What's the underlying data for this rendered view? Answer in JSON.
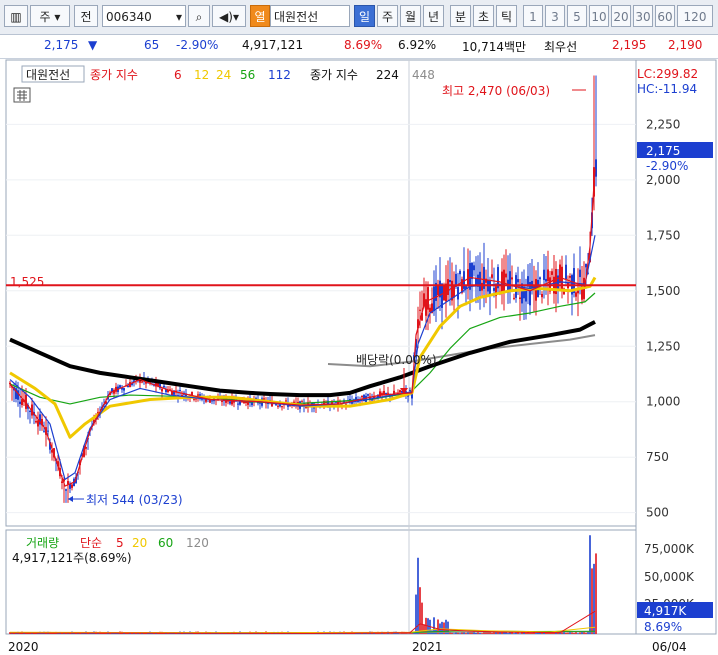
{
  "toolbar": {
    "market": "주",
    "type": "전",
    "code": "006340",
    "search_icon": "search-icon",
    "sound_icon": "speaker-icon",
    "badge": "열",
    "name": "대원전선",
    "periods": [
      "일",
      "주",
      "월",
      "년",
      "분",
      "초",
      "틱"
    ],
    "active_period": "일",
    "numbers": [
      "1",
      "3",
      "5",
      "10",
      "20",
      "30",
      "60",
      "120"
    ]
  },
  "quote": {
    "price": "2,175",
    "direction": "▼",
    "change": "65",
    "change_pct": "-2.90%",
    "volume": "4,917,121",
    "vol_pct": "8.69%",
    "turnover_pct": "6.92%",
    "amount": "10,714백만",
    "order_label": "최우선",
    "ask": "2,195",
    "bid": "2,190"
  },
  "legend": {
    "stock": "대원전선",
    "ma_label": "종가 지수",
    "ma_periods": [
      "6",
      "12",
      "24",
      "56",
      "112"
    ],
    "ma2_label": "종가 지수",
    "ma2_periods": [
      "224",
      "448"
    ]
  },
  "annotations": {
    "high": "최고 2,470 (06/03)",
    "low": "최저 544 (03/23)",
    "dividend": "배당락(0.00%)",
    "hline": "1,525"
  },
  "top_right": {
    "lc": "LC:299.82",
    "hc": "HC:-11.94"
  },
  "price_axis": {
    "ticks": [
      "2,250",
      "2,000",
      "1,750",
      "1,500",
      "1,250",
      "1,000",
      "750",
      "500"
    ],
    "current": "2,175",
    "current_pct": "-2.90%"
  },
  "volume": {
    "legend_label": "거래량",
    "ma_label": "단순",
    "ma_periods": [
      "5",
      "20",
      "60",
      "120"
    ],
    "current": "4,917,121주(8.69%)",
    "axis_ticks": [
      "75,000K",
      "50,000K",
      "25,000K"
    ],
    "current_box": "4,917K",
    "current_pct": "8.69%"
  },
  "date_axis": {
    "labels": [
      "2020",
      "2021"
    ],
    "right_label": "06/04"
  },
  "colors": {
    "up": "#e0141b",
    "down": "#1c3fd0",
    "ma6": "#e0141b",
    "ma12": "#f0c800",
    "ma24": "#17a514",
    "ma56": "#1c3fd0",
    "ma112": "#000000",
    "ma224": "#8c8c8c",
    "hline": "#e0141b"
  },
  "chart_data": {
    "type": "candlestick",
    "ylim": [
      440,
      2540
    ],
    "hline": 1525,
    "ma112": [
      [
        0,
        1280
      ],
      [
        30,
        1220
      ],
      [
        60,
        1160
      ],
      [
        90,
        1130
      ],
      [
        120,
        1110
      ],
      [
        150,
        1090
      ],
      [
        180,
        1070
      ],
      [
        210,
        1050
      ],
      [
        240,
        1040
      ],
      [
        260,
        1035
      ],
      [
        290,
        1030
      ],
      [
        320,
        1030
      ],
      [
        340,
        1040
      ],
      [
        360,
        1070
      ],
      [
        390,
        1110
      ],
      [
        420,
        1160
      ],
      [
        460,
        1220
      ],
      [
        500,
        1270
      ],
      [
        540,
        1300
      ],
      [
        570,
        1325
      ],
      [
        585,
        1360
      ]
    ],
    "ma224": [
      [
        318,
        1170
      ],
      [
        360,
        1160
      ],
      [
        400,
        1180
      ],
      [
        440,
        1210
      ],
      [
        480,
        1240
      ],
      [
        520,
        1260
      ],
      [
        560,
        1280
      ],
      [
        585,
        1300
      ]
    ],
    "ma56": [
      [
        0,
        1080
      ],
      [
        30,
        1020
      ],
      [
        60,
        990
      ],
      [
        90,
        1020
      ],
      [
        120,
        1030
      ],
      [
        160,
        1025
      ],
      [
        200,
        1020
      ],
      [
        240,
        1000
      ],
      [
        280,
        990
      ],
      [
        320,
        1000
      ],
      [
        360,
        1010
      ],
      [
        400,
        1040
      ],
      [
        420,
        1130
      ],
      [
        440,
        1240
      ],
      [
        460,
        1330
      ],
      [
        490,
        1380
      ],
      [
        520,
        1400
      ],
      [
        550,
        1430
      ],
      [
        575,
        1450
      ],
      [
        585,
        1490
      ]
    ],
    "ma24": [
      [
        0,
        1130
      ],
      [
        25,
        1060
      ],
      [
        45,
        990
      ],
      [
        60,
        840
      ],
      [
        75,
        900
      ],
      [
        100,
        980
      ],
      [
        140,
        1010
      ],
      [
        180,
        1020
      ],
      [
        220,
        1020
      ],
      [
        260,
        1000
      ],
      [
        300,
        980
      ],
      [
        340,
        980
      ],
      [
        380,
        1010
      ],
      [
        402,
        1040
      ],
      [
        410,
        1200
      ],
      [
        430,
        1340
      ],
      [
        450,
        1430
      ],
      [
        470,
        1470
      ],
      [
        500,
        1500
      ],
      [
        530,
        1510
      ],
      [
        560,
        1500
      ],
      [
        580,
        1520
      ],
      [
        585,
        1560
      ]
    ],
    "ma12": [
      [
        0,
        1100
      ],
      [
        20,
        1020
      ],
      [
        40,
        900
      ],
      [
        55,
        650
      ],
      [
        65,
        680
      ],
      [
        80,
        880
      ],
      [
        100,
        1010
      ],
      [
        130,
        1060
      ],
      [
        160,
        1030
      ],
      [
        200,
        1010
      ],
      [
        250,
        1000
      ],
      [
        290,
        980
      ],
      [
        330,
        990
      ],
      [
        370,
        1020
      ],
      [
        402,
        1045
      ],
      [
        408,
        1260
      ],
      [
        420,
        1400
      ],
      [
        440,
        1460
      ],
      [
        460,
        1520
      ],
      [
        490,
        1530
      ],
      [
        520,
        1510
      ],
      [
        550,
        1540
      ],
      [
        575,
        1530
      ],
      [
        585,
        1750
      ]
    ],
    "ma6": [
      [
        0,
        1080
      ],
      [
        15,
        1000
      ],
      [
        35,
        880
      ],
      [
        55,
        620
      ],
      [
        65,
        640
      ],
      [
        80,
        870
      ],
      [
        100,
        1040
      ],
      [
        130,
        1100
      ],
      [
        160,
        1050
      ],
      [
        200,
        1010
      ],
      [
        250,
        1000
      ],
      [
        290,
        985
      ],
      [
        330,
        990
      ],
      [
        370,
        1030
      ],
      [
        402,
        1040
      ],
      [
        406,
        1300
      ],
      [
        415,
        1450
      ],
      [
        430,
        1480
      ],
      [
        460,
        1560
      ],
      [
        490,
        1540
      ],
      [
        520,
        1500
      ],
      [
        550,
        1560
      ],
      [
        575,
        1520
      ],
      [
        580,
        1700
      ],
      [
        585,
        2050
      ]
    ],
    "volume_ylim": [
      0,
      90000
    ],
    "volume_ma5": [
      [
        0,
        800
      ],
      [
        100,
        900
      ],
      [
        200,
        700
      ],
      [
        300,
        600
      ],
      [
        400,
        1200
      ],
      [
        410,
        9000
      ],
      [
        430,
        4000
      ],
      [
        460,
        2500
      ],
      [
        500,
        1500
      ],
      [
        550,
        1200
      ],
      [
        585,
        20000
      ]
    ],
    "volume_ma20": [
      [
        0,
        1500
      ],
      [
        200,
        1200
      ],
      [
        400,
        1500
      ],
      [
        430,
        4500
      ],
      [
        480,
        2800
      ],
      [
        540,
        1800
      ],
      [
        585,
        6000
      ]
    ],
    "volume_ma60": [
      [
        0,
        1300
      ],
      [
        200,
        1100
      ],
      [
        400,
        1300
      ],
      [
        450,
        2800
      ],
      [
        520,
        2200
      ],
      [
        585,
        2400
      ]
    ],
    "volume_ma120": [
      [
        0,
        1200
      ],
      [
        200,
        1000
      ],
      [
        400,
        1100
      ],
      [
        480,
        1800
      ],
      [
        585,
        1900
      ]
    ]
  }
}
